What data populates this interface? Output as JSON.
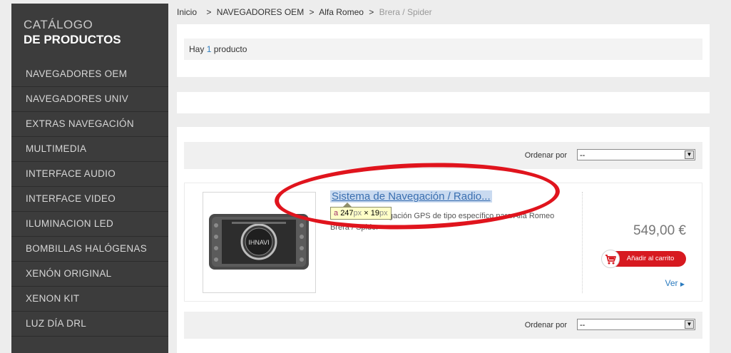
{
  "sidebar": {
    "title_line1": "CATÁLOGO",
    "title_line2": "DE PRODUCTOS",
    "items": [
      {
        "label": "NAVEGADORES OEM"
      },
      {
        "label": "NAVEGADORES UNIV"
      },
      {
        "label": "EXTRAS NAVEGACIÓN"
      },
      {
        "label": "MULTIMEDIA"
      },
      {
        "label": "INTERFACE AUDIO"
      },
      {
        "label": "INTERFACE VIDEO"
      },
      {
        "label": "ILUMINACION LED"
      },
      {
        "label": "BOMBILLAS HALÓGENAS"
      },
      {
        "label": "XENÓN ORIGINAL"
      },
      {
        "label": "XENON KIT"
      },
      {
        "label": "LUZ DÍA DRL"
      }
    ]
  },
  "breadcrumb": {
    "home": "Inicio",
    "sep1": ">",
    "level1": "NAVEGADORES OEM",
    "sep2": ">",
    "level2": "Alfa Romeo",
    "sep3": ">",
    "current": "Brera / Spider"
  },
  "results": {
    "prefix": "Hay",
    "count": "1",
    "suffix": "producto"
  },
  "sort": {
    "label": "Ordenar por",
    "value": "--",
    "label_bottom": "Ordenar por",
    "value_bottom": "--"
  },
  "product": {
    "title": "Sistema de Navegación / Radio...",
    "description": "Sistema de navegación GPS de tipo específico para Alfa Romeo Brera / Spider",
    "image_text": "IHNAVI",
    "price": "549,00 €",
    "cart_label": "Añadir al carrito",
    "view_label": "Ver"
  },
  "inspector_tooltip": {
    "tag": "a",
    "width": "247",
    "unit1": "px",
    "times": "×",
    "height": "19",
    "unit2": "px"
  },
  "colors": {
    "sidebar_bg": "#3c3c3c",
    "link_blue": "#2a7bbf",
    "cart_red": "#d71920",
    "annotation_red": "#e0141d"
  }
}
